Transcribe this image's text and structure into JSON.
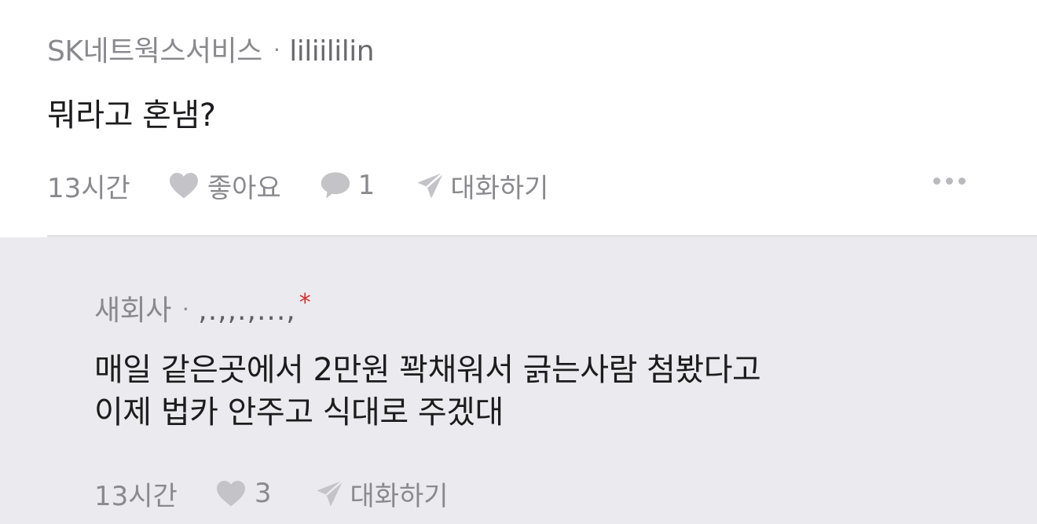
{
  "comment": {
    "company": "SK네트웍스서비스",
    "separator": "·",
    "nickname": "liliililin",
    "text": "뭐라고 혼냄?",
    "time": "13시간",
    "like_label": "좋아요",
    "reply_count": "1",
    "chat_label": "대화하기",
    "icons": [
      "heart-icon",
      "speech-bubble-icon",
      "paper-plane-icon",
      "more-dots-icon"
    ]
  },
  "reply": {
    "company": "새회사",
    "separator": "·",
    "nickname": ",.,,.,...,",
    "verified_mark": "*",
    "text_line1": "매일 같은곳에서 2만원 꽉채워서 긁는사람 첨봤다고",
    "text_line2": "이제 법카 안주고 식대로 주겠대",
    "time": "13시간",
    "like_count": "3",
    "chat_label": "대화하기",
    "icons": [
      "heart-icon",
      "paper-plane-icon"
    ]
  },
  "colors": {
    "meta_text": "#8a8a8e",
    "body_text": "#1c1c1e",
    "reply_background": "#ebebef",
    "icon_gray": "#c4c4c8",
    "star_red": "#d32f2f"
  }
}
